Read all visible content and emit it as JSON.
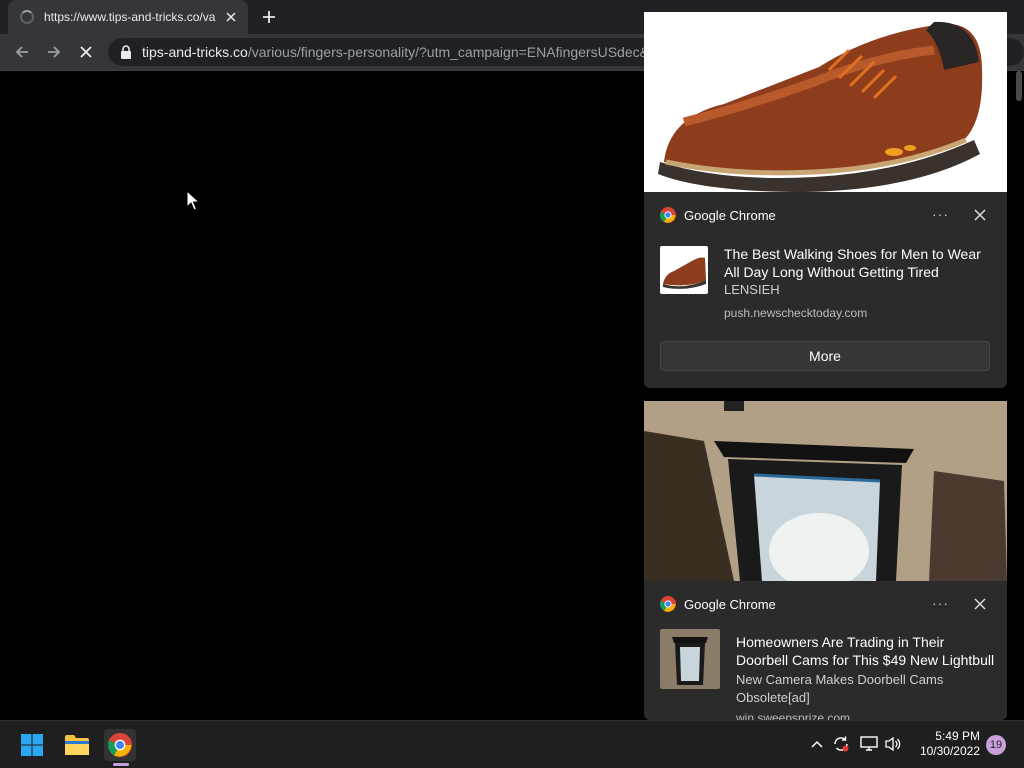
{
  "browser": {
    "tab": {
      "title": "https://www.tips-and-tricks.co/va",
      "loading": true
    },
    "address": {
      "host": "tips-and-tricks.co",
      "path": "/various/fingers-personality/?utm_campaign=ENAfingersUSdec&"
    }
  },
  "notifications": [
    {
      "app": "Google Chrome",
      "more_dots": "···",
      "title": "The Best Walking Shoes for Men to Wear All Day Long Without Getting Tired",
      "subtitle": "LENSIEH",
      "source": "push.newschecktoday.com",
      "button": "More",
      "image": "brown-leather-shoe"
    },
    {
      "app": "Google Chrome",
      "more_dots": "···",
      "title": "Homeowners Are Trading in Their Doorbell Cams for This $49 New Lightbull",
      "subtitle": "New Camera Makes Doorbell Cams Obsolete[ad]",
      "source": "win.sweepsprize.com",
      "image": "outdoor-lantern-light"
    }
  ],
  "taskbar": {
    "apps": [
      "windows-start",
      "file-explorer",
      "google-chrome"
    ],
    "clock": {
      "time": "5:49 PM",
      "date": "10/30/2022"
    },
    "notification_count": "19"
  },
  "colors": {
    "accent": "#c9a0dc",
    "tab_bg": "#35363a",
    "frame_bg": "#202124"
  }
}
